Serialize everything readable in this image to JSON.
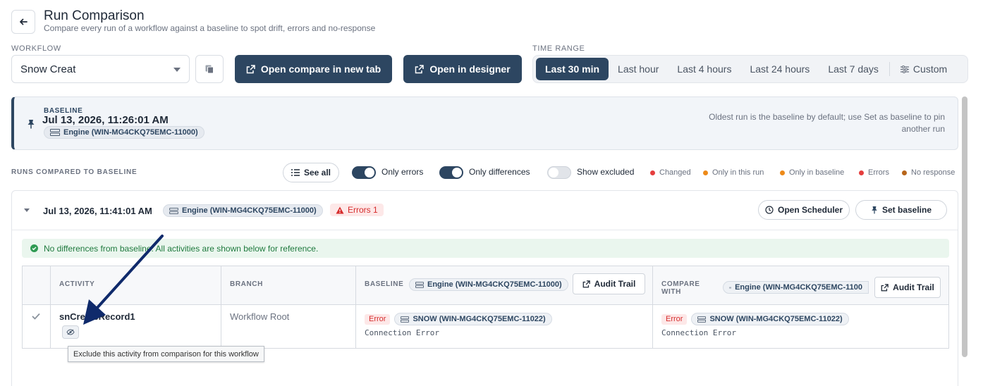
{
  "header": {
    "title": "Run Comparison",
    "subtitle": "Compare every run of a workflow against a baseline to spot drift, errors and no-response"
  },
  "workflow": {
    "label": "WORKFLOW",
    "selected": "Snow Creat"
  },
  "actions": {
    "open_compare": "Open compare in new tab",
    "open_designer": "Open in designer"
  },
  "time_range": {
    "label": "TIME RANGE",
    "options": [
      "Last 30 min",
      "Last hour",
      "Last 4 hours",
      "Last 24 hours",
      "Last 7 days",
      "Custom"
    ],
    "active": "Last 30 min"
  },
  "baseline": {
    "label": "BASELINE",
    "date": "Jul 13, 2026, 11:26:01 AM",
    "engine": "Engine (WIN-MG4CKQ75EMC-11000)",
    "note": "Oldest run is the baseline by default; use Set as baseline to pin another run"
  },
  "filters": {
    "section_label": "RUNS COMPARED TO BASELINE",
    "see_all": "See all",
    "only_errors": "Only errors",
    "only_differences": "Only differences",
    "show_excluded": "Show excluded",
    "only_errors_on": true,
    "only_differences_on": true,
    "show_excluded_on": false
  },
  "legend": [
    {
      "label": "Changed",
      "color": "#e53e3e"
    },
    {
      "label": "Only in this run",
      "color": "#ed8a19"
    },
    {
      "label": "Only in baseline",
      "color": "#ed8a19"
    },
    {
      "label": "Errors",
      "color": "#e53e3e"
    },
    {
      "label": "No response",
      "color": "#b7651a"
    }
  ],
  "run": {
    "date": "Jul 13, 2026, 11:41:01 AM",
    "engine": "Engine (WIN-MG4CKQ75EMC-11000)",
    "errors": "Errors 1",
    "open_scheduler": "Open Scheduler",
    "set_baseline": "Set baseline",
    "banner": "No differences from baseline. All activities are shown below for reference."
  },
  "table": {
    "headers": {
      "activity": "ACTIVITY",
      "branch": "BRANCH",
      "baseline": "BASELINE",
      "baseline_engine": "Engine (WIN-MG4CKQ75EMC-11000)",
      "compare_with_1": "COMPARE",
      "compare_with_2": "WITH",
      "compare_engine": "Engine (WIN-MG4CKQ75EMC-1100",
      "audit_trail": "Audit Trail"
    },
    "rows": [
      {
        "activity": "snCreateRecord1",
        "branch": "Workflow Root",
        "baseline_status": "Error",
        "baseline_engine": "SNOW (WIN-MG4CKQ75EMC-11022)",
        "baseline_message": "Connection Error",
        "compare_status": "Error",
        "compare_engine": "SNOW (WIN-MG4CKQ75EMC-11022)",
        "compare_message": "Connection Error"
      }
    ]
  },
  "tooltip": "Exclude this activity from comparison for this workflow",
  "colors": {
    "primary": "#2d4661",
    "error": "#d62c2c",
    "success": "#1f7a3e",
    "annotation_arrow": "#0f2a6b"
  }
}
